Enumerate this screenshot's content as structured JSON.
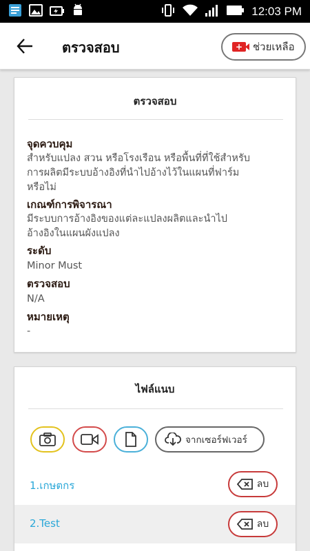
{
  "status_bar": {
    "time": "12:03 PM",
    "left_icons": [
      "keyboard-icon",
      "image-icon",
      "battery-saver-icon",
      "android-icon"
    ],
    "right_icons": [
      "vibrate-icon",
      "wifi-icon",
      "signal-icon",
      "battery-icon"
    ]
  },
  "header": {
    "title": "ตรวจสอบ",
    "help_label": "ช่วยเหลือ"
  },
  "inspection": {
    "card_title": "ตรวจสอบ",
    "fields": [
      {
        "label": "จุดควบคุม",
        "value_lines": [
          "สำหรับแปลง สวน หรือโรงเรือน หรือพื้นที่ที่ใช้สำหรับ",
          "การผลิตมีระบบอ้างอิงที่นำไปอ้างไว้ในแผนที่ฟาร์ม",
          "หรือไม่"
        ]
      },
      {
        "label": "เกณฑ์การพิจารณา",
        "value_lines": [
          "มีระบบการอ้างอิงของแต่ละแปลงผลิตและนำไป",
          "อ้างอิงในแผนผังแปลง"
        ]
      },
      {
        "label": "ระดับ",
        "value_lines": [
          "Minor Must"
        ]
      },
      {
        "label": "ตรวจสอบ",
        "value_lines": [
          "N/A"
        ]
      },
      {
        "label": "หมายเหตุ",
        "value_lines": [
          "-"
        ]
      }
    ]
  },
  "attachments": {
    "card_title": "ไฟล์แนบ",
    "server_label": "จากเซอร์ฟเวอร์",
    "files": [
      {
        "name": "1.เกษตกร",
        "delete_label": "ลบ"
      },
      {
        "name": "2.Test",
        "delete_label": "ลบ"
      }
    ]
  },
  "colors": {
    "accent_blue": "#29a7d8",
    "delete_red": "#c73a3a",
    "photo_yellow": "#e3c21d",
    "video_red": "#d34a4a",
    "file_blue": "#4ab0d9"
  }
}
